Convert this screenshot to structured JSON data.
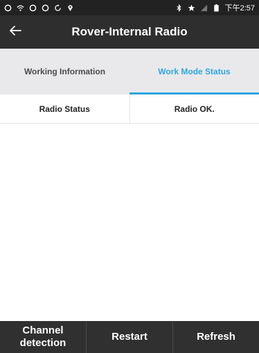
{
  "status_bar": {
    "time": "下午2:57",
    "left_icons": [
      "app-icon",
      "wifi-icon",
      "app-icon",
      "app-icon",
      "sync-icon",
      "location-icon"
    ],
    "right_icons": [
      "bluetooth-icon",
      "star-icon",
      "signal-icon",
      "battery-icon"
    ]
  },
  "app_bar": {
    "title": "Rover-Internal Radio",
    "back_icon": "arrow-left-icon"
  },
  "tabs": [
    {
      "label": "Working Information",
      "active": false
    },
    {
      "label": "Work Mode Status",
      "active": true
    }
  ],
  "status": {
    "label": "Radio Status",
    "value": "Radio OK."
  },
  "bottom_buttons": [
    {
      "label": "Channel\ndetection"
    },
    {
      "label": "Restart"
    },
    {
      "label": "Refresh"
    }
  ],
  "colors": {
    "accent": "#2ea6e0",
    "app_bar": "#2e2e2e",
    "bottom_bar": "#303030"
  }
}
